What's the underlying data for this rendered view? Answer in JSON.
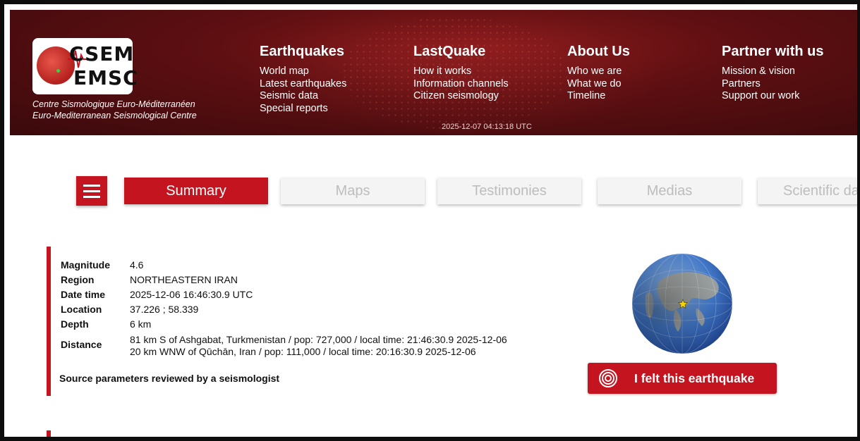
{
  "header": {
    "logo": {
      "line1": "CSEM",
      "line2": "EMSC"
    },
    "tagline_fr": "Centre Sismologique Euro-Méditerranéen",
    "tagline_en": "Euro-Mediterranean Seismological Centre",
    "timestamp": "2025-12-07 04:13:18 UTC",
    "nav": [
      {
        "title": "Earthquakes",
        "links": [
          "World map",
          "Latest earthquakes",
          "Seismic data",
          "Special reports"
        ]
      },
      {
        "title": "LastQuake",
        "links": [
          "How it works",
          "Information channels",
          "Citizen seismology"
        ]
      },
      {
        "title": "About Us",
        "links": [
          "Who we are",
          "What we do",
          "Timeline"
        ]
      },
      {
        "title": "Partner with us",
        "links": [
          "Mission & vision",
          "Partners",
          "Support our work"
        ]
      }
    ]
  },
  "tabs": [
    {
      "label": "Summary",
      "active": true
    },
    {
      "label": "Maps",
      "active": false
    },
    {
      "label": "Testimonies",
      "active": false
    },
    {
      "label": "Medias",
      "active": false
    },
    {
      "label": "Scientific da",
      "active": false
    }
  ],
  "quake": {
    "magnitude_label": "Magnitude",
    "magnitude": "4.6",
    "region_label": "Region",
    "region": "NORTHEASTERN IRAN",
    "datetime_label": "Date time",
    "datetime": "2025-12-06 16:46:30.9 UTC",
    "location_label": "Location",
    "location": "37.226 ; 58.339",
    "depth_label": "Depth",
    "depth": "6 km",
    "distance_label": "Distance",
    "distance_1": "81 km S of Ashgabat, Turkmenistan / pop: 727,000 / local time: 21:46:30.9 2025-12-06",
    "distance_2": "20 km WNW of Qūchān, Iran / pop: 111,000 / local time: 20:16:30.9 2025-12-06",
    "reviewed": "Source parameters reviewed by a seismologist"
  },
  "felt_button": {
    "label": "I felt this earthquake"
  },
  "colors": {
    "brand_red": "#c41420",
    "header_dark": "#5e0f12"
  }
}
